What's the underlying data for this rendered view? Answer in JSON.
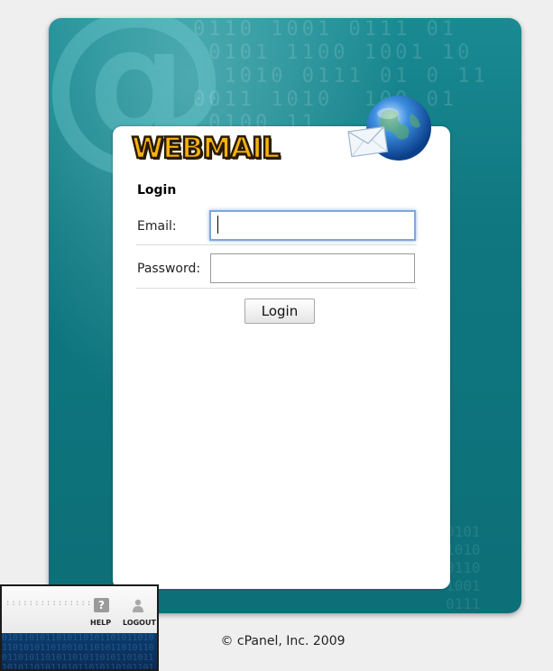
{
  "brand": {
    "logo_text": "WEBMAIL"
  },
  "form": {
    "heading": "Login",
    "email_label": "Email:",
    "email_value": "",
    "password_label": "Password:",
    "password_value": "",
    "submit_label": "Login"
  },
  "footer": {
    "copyright": "© cPanel, Inc. 2009"
  },
  "overlay": {
    "help_label": "HELP",
    "logout_label": "LOGOUT"
  },
  "colors": {
    "panel_teal": "#0f7780",
    "logo_fill": "#f6b30a",
    "focus_ring": "#7ea7da"
  }
}
